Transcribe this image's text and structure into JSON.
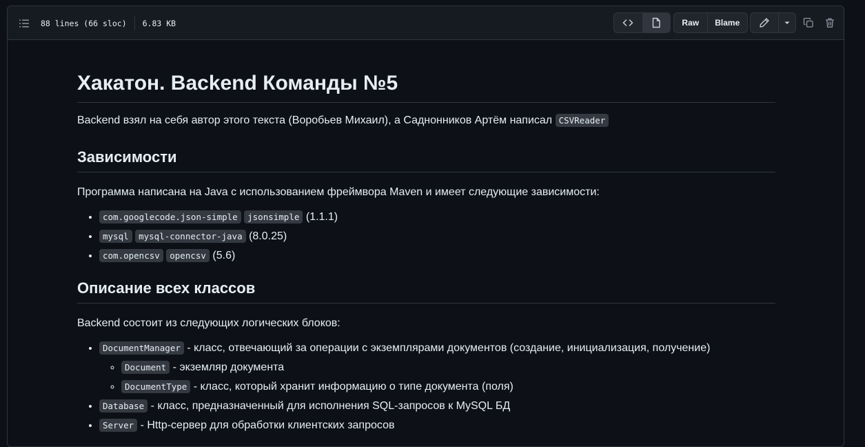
{
  "header": {
    "lines": "88 lines (66 sloc)",
    "size": "6.83 KB",
    "raw_label": "Raw",
    "blame_label": "Blame"
  },
  "readme": {
    "title": "Хакатон. Backend Команды №5",
    "intro_text": "Backend взял на себя автор этого текста (Воробьев Михаил), а Саднонников Артём написал ",
    "intro_code": "CSVReader",
    "deps_heading": "Зависимости",
    "deps_text": "Программа написана на Java с использованием фреймвора Maven и имеет следующие зависимости:",
    "deps": [
      {
        "group": "com.googlecode.json-simple",
        "artifact": "jsonsimple",
        "version": "(1.1.1)"
      },
      {
        "group": "mysql",
        "artifact": "mysql-connector-java",
        "version": "(8.0.25)"
      },
      {
        "group": "com.opencsv",
        "artifact": "opencsv",
        "version": "(5.6)"
      }
    ],
    "classes_heading": "Описание всех классов",
    "classes_text": "Backend состоит из следующих логических блоков:",
    "classes": [
      {
        "code": "DocumentManager",
        "desc": " - класс, отвечающий за операции с экземплярами документов (создание, инициализация, получение)"
      },
      {
        "code": "Document",
        "desc": " - экземляр документа"
      },
      {
        "code": "DocumentType",
        "desc": " - класс, который хранит информацию о типе документа (поля)"
      },
      {
        "code": "Database",
        "desc": " - класс, предназначенный для исполнения SQL-запросов к MySQL БД"
      },
      {
        "code": "Server",
        "desc": " - Http-сервер для обработки клиентских запросов"
      }
    ]
  }
}
